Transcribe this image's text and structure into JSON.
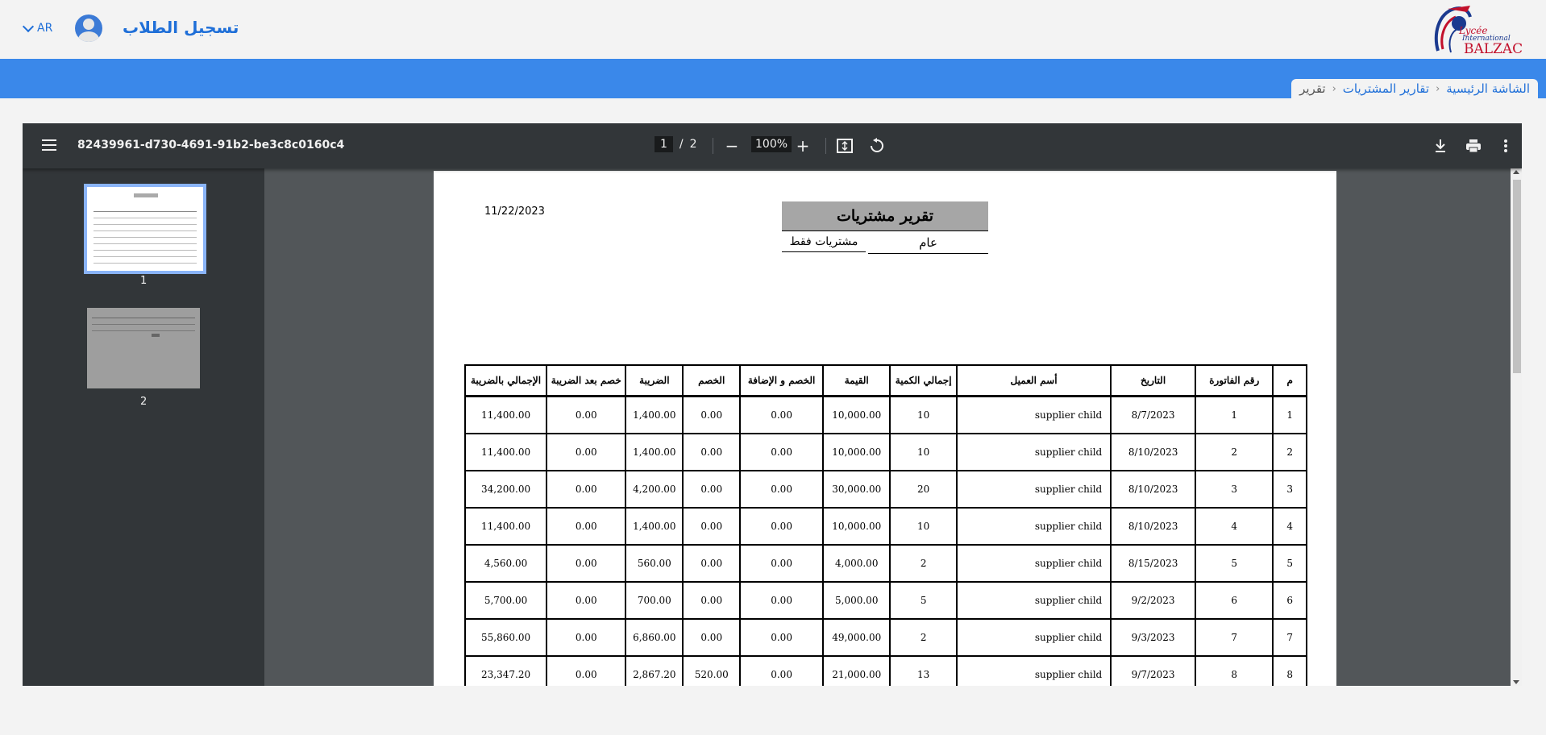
{
  "header": {
    "lang": "AR",
    "app_title": "تسجيل الطلاب",
    "logo_line1": "Lycée",
    "logo_line2": "International",
    "logo_line3": "BALZAC"
  },
  "breadcrumb": {
    "home": "الشاشة الرئيسية",
    "purchase_reports": "تقارير المشتريات",
    "current": "تقرير"
  },
  "viewer": {
    "file_name": "82439961-d730-4691-91b2-be3c8c0160c4",
    "current_page": "1",
    "page_sep": "/",
    "total_pages": "2",
    "zoom": "100%",
    "thumb1_label": "1",
    "thumb2_label": "2"
  },
  "report": {
    "date": "11/22/2023",
    "title": "تقرير مشتريات",
    "type": "عام",
    "filter": "مشتريات فقط",
    "columns": [
      "م",
      "رقم الفاتورة",
      "التاريخ",
      "أسم العميل",
      "إجمالي الكمية",
      "القيمة",
      "الخصم و الإضافة",
      "الخصم",
      "الضريبة",
      "خصم بعد الضريبة",
      "الإجمالي بالضريبة"
    ],
    "rows": [
      [
        "1",
        "1",
        "8/7/2023",
        "supplier child",
        "10",
        "10,000.00",
        "0.00",
        "0.00",
        "1,400.00",
        "0.00",
        "11,400.00"
      ],
      [
        "2",
        "2",
        "8/10/2023",
        "supplier child",
        "10",
        "10,000.00",
        "0.00",
        "0.00",
        "1,400.00",
        "0.00",
        "11,400.00"
      ],
      [
        "3",
        "3",
        "8/10/2023",
        "supplier child",
        "20",
        "30,000.00",
        "0.00",
        "0.00",
        "4,200.00",
        "0.00",
        "34,200.00"
      ],
      [
        "4",
        "4",
        "8/10/2023",
        "supplier child",
        "10",
        "10,000.00",
        "0.00",
        "0.00",
        "1,400.00",
        "0.00",
        "11,400.00"
      ],
      [
        "5",
        "5",
        "8/15/2023",
        "supplier child",
        "2",
        "4,000.00",
        "0.00",
        "0.00",
        "560.00",
        "0.00",
        "4,560.00"
      ],
      [
        "6",
        "6",
        "9/2/2023",
        "supplier child",
        "5",
        "5,000.00",
        "0.00",
        "0.00",
        "700.00",
        "0.00",
        "5,700.00"
      ],
      [
        "7",
        "7",
        "9/3/2023",
        "supplier child",
        "2",
        "49,000.00",
        "0.00",
        "0.00",
        "6,860.00",
        "0.00",
        "55,860.00"
      ],
      [
        "8",
        "8",
        "9/7/2023",
        "supplier child",
        "13",
        "21,000.00",
        "0.00",
        "520.00",
        "2,867.20",
        "0.00",
        "23,347.20"
      ]
    ]
  }
}
